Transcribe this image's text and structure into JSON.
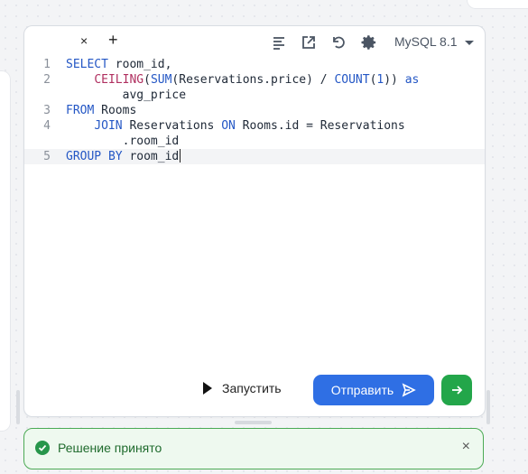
{
  "tabs": {
    "close_label": "×",
    "add_label": "+"
  },
  "toolbar": {
    "icons": [
      "format-icon",
      "open-external-icon",
      "reset-icon",
      "settings-icon"
    ],
    "db_version": "MySQL 8.1"
  },
  "editor": {
    "lines": [
      {
        "number": "1",
        "text": "SELECT room_id,"
      },
      {
        "number": "2",
        "text": "    CEILING(SUM(Reservations.price) / COUNT(1)) as"
      },
      {
        "number": "",
        "text": "        avg_price"
      },
      {
        "number": "3",
        "text": "FROM Rooms"
      },
      {
        "number": "4",
        "text": "    JOIN Reservations ON Rooms.id = Reservations"
      },
      {
        "number": "",
        "text": "        .room_id"
      },
      {
        "number": "5",
        "text": "GROUP BY room_id"
      }
    ]
  },
  "actions": {
    "run_label": "Запустить",
    "submit_label": "Отправить"
  },
  "status": {
    "message": "Решение принято",
    "close_label": "×"
  },
  "colors": {
    "submit": "#2f6fe4",
    "next": "#23a64a",
    "success_border": "#4caa55",
    "success_background": "#eef9ef",
    "keyword": "#2457c5",
    "function": "#b03060"
  }
}
